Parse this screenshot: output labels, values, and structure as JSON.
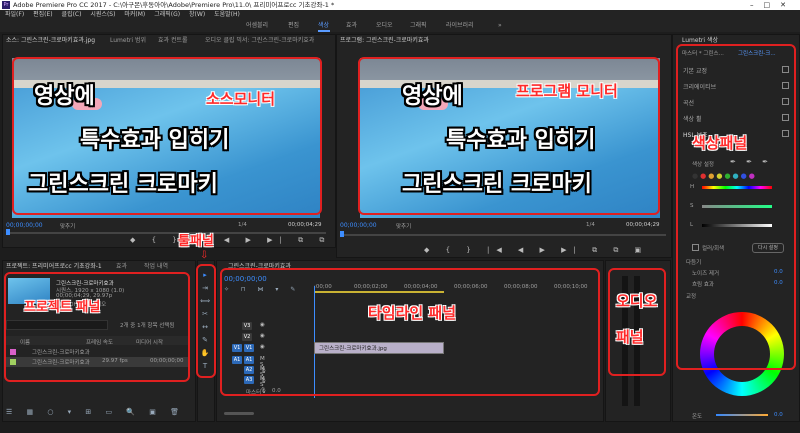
{
  "window": {
    "title": "Adobe Premiere Pro CC 2017 - C:\\아구몬\\후동아아\\Adobe\\Premiere Pro\\11.0\\ 프리미어프로cc 기초강좌-1 *",
    "controls": [
      "–",
      "□",
      "✕"
    ]
  },
  "menu": [
    "파일(F)",
    "편집(E)",
    "클립(C)",
    "시퀀스(S)",
    "마커(M)",
    "그래픽(G)",
    "창(W)",
    "도움말(H)"
  ],
  "workspaces": {
    "items": [
      "어셈블리",
      "편집",
      "색상",
      "효과",
      "오디오",
      "그래픽",
      "라이브러리"
    ],
    "active": "색상",
    "more": "»"
  },
  "source_monitor": {
    "tabs": [
      "소스: 그린스크린-크로마키효과.jpg",
      "Lumetri 범위",
      "효과 컨트롤",
      "오디오 클립 믹서: 그린스크린-크로마키효과"
    ],
    "timecode": "00;00;00;00",
    "fit": "맞추기",
    "ratio": "1/4",
    "duration": "00;00;04;29"
  },
  "program_monitor": {
    "tab": "프로그램: 그린스크린-크로마키효과",
    "timecode": "00;00;00;00",
    "fit": "맞추기",
    "ratio": "1/4",
    "duration": "00;00;04;29"
  },
  "project_panel": {
    "tabs": [
      "프로젝트: 프리미어프로cc 기초강좌-1",
      "효과",
      "작업 내역"
    ],
    "file_name": "그린스크린-크로마키효과",
    "file_info": [
      "시퀀스, 1920 x 1080 (1.0)",
      "00;00;04;29, 29.97p",
      "48000Hz - 스테레오"
    ],
    "status": "2개 중 1개 항목 선택됨",
    "columns": [
      "이름",
      "프레임 속도",
      "미디어 시작"
    ],
    "items": [
      {
        "name": "그린스크린-크로마키효과",
        "fps": "",
        "start": ""
      },
      {
        "name": "그린스크린-크로마키효과",
        "fps": "29.97 fps",
        "start": "00;00;00;00"
      }
    ]
  },
  "timeline": {
    "tab": "그린스크린-크로마키효과",
    "timecode": "00;00;00;00",
    "ruler": [
      ":00;00",
      "00;00;02;00",
      "00;00;04;00",
      "00;00;06;00",
      "00;00;08;00",
      "00;00;10;00"
    ],
    "video_tracks": [
      "V3",
      "V2",
      "V1"
    ],
    "audio_tracks": [
      "A1",
      "A2",
      "A3"
    ],
    "master": "마스터",
    "master_value": "0.0",
    "clip": "그린스크린-크로마키효과.jpg"
  },
  "lumetri": {
    "header_tab": "Lumetri 색상",
    "dropdowns": [
      "마스터 * 그린스...",
      "그린스크린-크..."
    ],
    "sections": [
      "기본 교정",
      "크리에이티브",
      "곡선",
      "색상 휠",
      "HSL 보조"
    ],
    "key_label": "색상 설정",
    "channels": [
      "H",
      "S",
      "L"
    ],
    "mask": "컬러/회색",
    "reset": "다시 설정",
    "refine": "다듬기",
    "noise": "노이즈 제거",
    "noise_val": "0.0",
    "blur": "흐림 효과",
    "blur_val": "0.0",
    "correction": "교정",
    "temperature": "온도",
    "temp_val": "0.0"
  },
  "annotations": {
    "overlay_line1": "영상에",
    "overlay_line2": "특수효과 입히기",
    "overlay_line3": "그린스크린 크로마키",
    "source_label": "소스모니터",
    "program_label": "프로그램 모니터",
    "tools_label": "툴패널",
    "project_label": "프로젝트 패널",
    "timeline_label": "타임라인 패널",
    "audio_label_1": "오디오",
    "audio_label_2": "패널",
    "lumetri_label": "색상패널"
  }
}
